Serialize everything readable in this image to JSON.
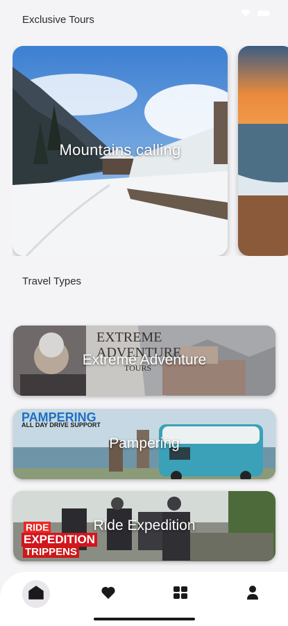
{
  "sections": {
    "exclusive_title": "Exclusive Tours",
    "types_title": "Travel Types"
  },
  "tours": [
    {
      "label": "Mountains calling",
      "image": "snowy mountain village"
    },
    {
      "label": "",
      "image": "beach sunset"
    }
  ],
  "travel_types": [
    {
      "label": "Extreme Adventure",
      "overlay_line1": "EXTREME",
      "overlay_line2": "ADVENTURE",
      "overlay_line3": "TOURS"
    },
    {
      "label": "Pampering",
      "overlay_line1": "PAMPERING",
      "overlay_line2": "ALL DAY DRIVE SUPPORT"
    },
    {
      "label": "Ride Expedition",
      "overlay_line1": "RIDE",
      "overlay_line2": "EXPEDITION",
      "overlay_line3": "TRIPPENS"
    }
  ],
  "nav": {
    "items": [
      {
        "icon": "home-icon",
        "active": true
      },
      {
        "icon": "heart-icon",
        "active": false
      },
      {
        "icon": "grid-icon",
        "active": false
      },
      {
        "icon": "user-icon",
        "active": false
      }
    ]
  },
  "colors": {
    "background": "#f4f4f6",
    "nav_background": "#ffffff",
    "active_nav": "#e9e6ec",
    "icon": "#1a1a1a"
  }
}
